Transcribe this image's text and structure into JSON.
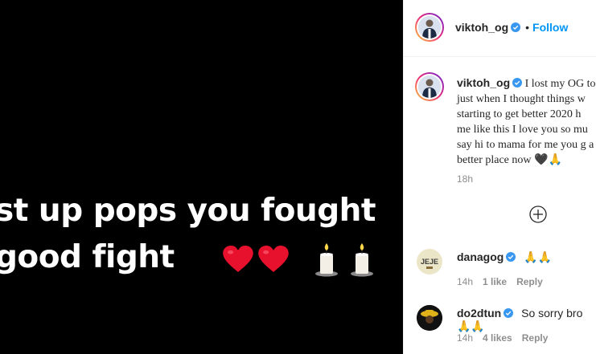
{
  "media": {
    "line1": "st up pops you fought",
    "line2": "good fight"
  },
  "header": {
    "username": "viktoh_og",
    "separator": "•",
    "follow_label": "Follow"
  },
  "caption": {
    "username": "viktoh_og",
    "text": "I lost my OG to just when I thought things w starting to get better 2020 h me like this I love you so mu say hi to mama for me you g a better place now 🖤🙏",
    "time": "18h"
  },
  "comments": [
    {
      "username": "danagog",
      "text": "🙏🙏",
      "time": "14h",
      "likes": "1 like",
      "reply": "Reply",
      "avatar_text": "JEJE"
    },
    {
      "username": "do2dtun",
      "text": "So sorry bro 🙏🙏",
      "time": "14h",
      "likes": "4 likes",
      "reply": "Reply"
    }
  ],
  "colors": {
    "accent": "#0095f6",
    "verified": "#3897f0",
    "muted": "#8e8e8e",
    "text": "#262626"
  }
}
